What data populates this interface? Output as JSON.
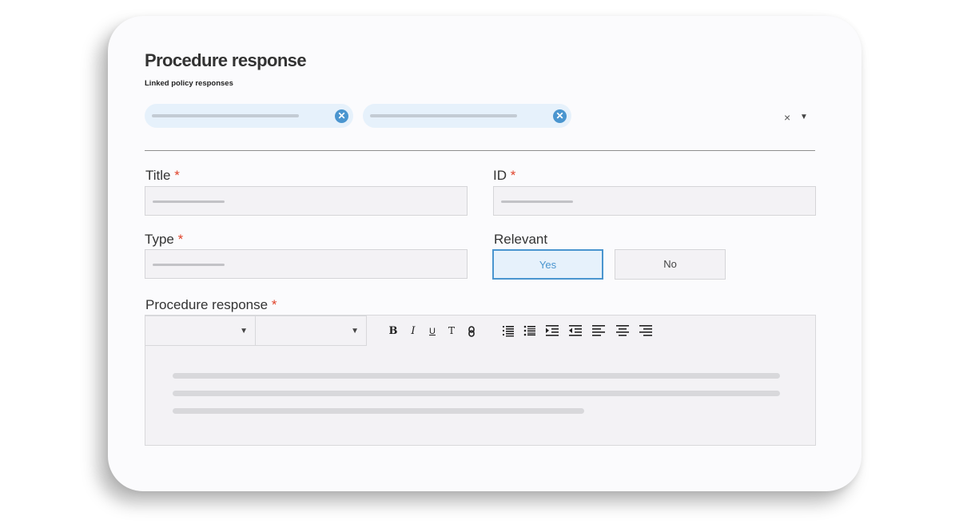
{
  "form": {
    "title": "Procedure response",
    "linked_label": "Linked policy responses",
    "chips_clear": "×",
    "chips_toggle": "▼"
  },
  "fields": {
    "title_label": "Title",
    "id_label": "ID",
    "type_label": "Type",
    "relevant_label": "Relevant",
    "required_mark": "*",
    "relevant_options": [
      "Yes",
      "No"
    ],
    "relevant_selected": "Yes"
  },
  "editor": {
    "label": "Procedure response",
    "dropdown_arrow": "▼",
    "toolbar": {
      "bold": "B",
      "italic": "I",
      "underline": "U",
      "text": "T",
      "link": "🔗"
    }
  },
  "colors": {
    "accent": "#4a95cf",
    "required": "#e0432b",
    "chip_bg": "#e6f1fb"
  },
  "icons": [
    "close-circle-icon",
    "clear-icon",
    "chevron-down-icon",
    "bold-icon",
    "italic-icon",
    "underline-icon",
    "text-style-icon",
    "link-icon",
    "ordered-list-icon",
    "bullet-list-icon",
    "indent-icon",
    "outdent-icon",
    "align-left-icon",
    "align-center-icon",
    "align-right-icon"
  ]
}
